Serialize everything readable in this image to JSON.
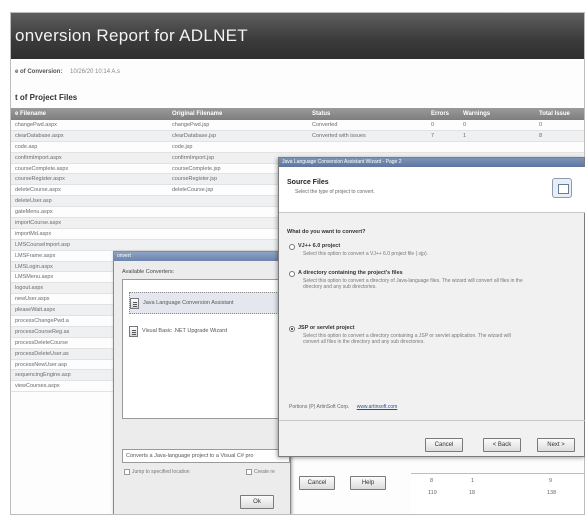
{
  "report": {
    "title": "onversion Report for ADLNET",
    "date_label": "e of Conversion:",
    "date_value": "10/26/20 10:14 A.s",
    "section_title": "t of Project Files",
    "columns": [
      "e Filename",
      "Original Filename",
      "Status",
      "Errors",
      "Warnings",
      "Total Issue"
    ],
    "rows": [
      [
        "changePwd.aspx",
        "changePwd.jsp",
        "Converted",
        "0",
        "0",
        "0"
      ],
      [
        "clearDatabase.aspx",
        "clearDatabase.jsp",
        "Converted with issues",
        "7",
        "1",
        "8"
      ],
      [
        "code.asp",
        "code.jsp",
        "",
        "",
        "",
        ""
      ],
      [
        "confirmImport.aspx",
        "confirmImport.jsp",
        "",
        "",
        "",
        ""
      ],
      [
        "courseComplete.aspx",
        "courseComplete.jsp",
        "",
        "",
        "",
        ""
      ],
      [
        "courseRegister.aspx",
        "courseRegister.jsp",
        "",
        "",
        "",
        ""
      ],
      [
        "deleteCourse.aspx",
        "deleteCourse.jsp",
        "",
        "",
        "",
        ""
      ],
      [
        "deleteUser.asp",
        "",
        "",
        "",
        "",
        ""
      ],
      [
        "gateMenu.aspx",
        "",
        "",
        "",
        "",
        ""
      ],
      [
        "importCourse.aspx",
        "",
        "",
        "",
        "",
        ""
      ],
      [
        "importMd.aspx",
        "",
        "",
        "",
        "",
        ""
      ],
      [
        "LMSCourseImport.asp",
        "",
        "",
        "",
        "",
        ""
      ],
      [
        "LMSFrame.aspx",
        "",
        "",
        "",
        "",
        ""
      ],
      [
        "LMSLogin.aspx",
        "",
        "",
        "",
        "",
        ""
      ],
      [
        "LMSMenu.aspx",
        "",
        "",
        "",
        "",
        ""
      ],
      [
        "logout.aspx",
        "",
        "",
        "",
        "",
        ""
      ],
      [
        "newUser.aspx",
        "",
        "",
        "",
        "",
        ""
      ],
      [
        "pleaseWait.aspx",
        "",
        "",
        "",
        "",
        ""
      ],
      [
        "processChangePwd.a",
        "",
        "",
        "",
        "",
        ""
      ],
      [
        "processCourseReg.as",
        "",
        "",
        "",
        "",
        ""
      ],
      [
        "processDeleteCourse",
        "",
        "",
        "",
        "",
        ""
      ],
      [
        "processDeleteUser.as",
        "",
        "",
        "",
        "",
        ""
      ],
      [
        "processNewUser.asp",
        "",
        "",
        "",
        "",
        ""
      ],
      [
        "sequencingEngine.asp",
        "",
        "",
        "",
        "",
        ""
      ],
      [
        "viewCourses.aspx",
        "",
        "",
        "",
        "",
        ""
      ]
    ]
  },
  "convert_dialog": {
    "caption": "onvert",
    "list_label": "Available Converters:",
    "items": [
      "Java Language Conversion Assistant",
      "Visual Basic .NET Upgrade Wizard"
    ],
    "description": "Converts a Java-language project to a Visual C# pro",
    "check_left": "Jump to specified location",
    "check_right": "Create re",
    "ok": "Ok",
    "cancel": "Cancel",
    "help": "Help"
  },
  "wizard": {
    "caption": "Java Language Conversion Assistant Wizard - Page 2",
    "header_title": "Source Files",
    "header_sub": "Select the type of project to convert.",
    "question": "What do you want to convert?",
    "options": [
      {
        "title": "VJ++ 6.0 project",
        "desc": "Select this option to convert a VJ++ 6.0 project file (.vjp).",
        "selected": false
      },
      {
        "title": "A directory containing the project's files",
        "desc": "Select this option to convert a directory of Java-language files. The wizard will convert all files in the directory and any sub directories.",
        "selected": false
      },
      {
        "title": "JSP or servlet project",
        "desc": "Select this option to convert a directory containing a JSP or servlet application. The wizard will convert all files in the directory and any sub directories.",
        "selected": true
      }
    ],
    "footer_label": "Portions (P) ArtinSoft Corp.",
    "footer_link": "www.artinsoft.com",
    "cancel": "Cancel",
    "back": "< Back",
    "next": "Next >"
  },
  "summary": {
    "r1": [
      "8",
      "1",
      "9"
    ],
    "r2": [
      "119",
      "18",
      "138"
    ]
  }
}
